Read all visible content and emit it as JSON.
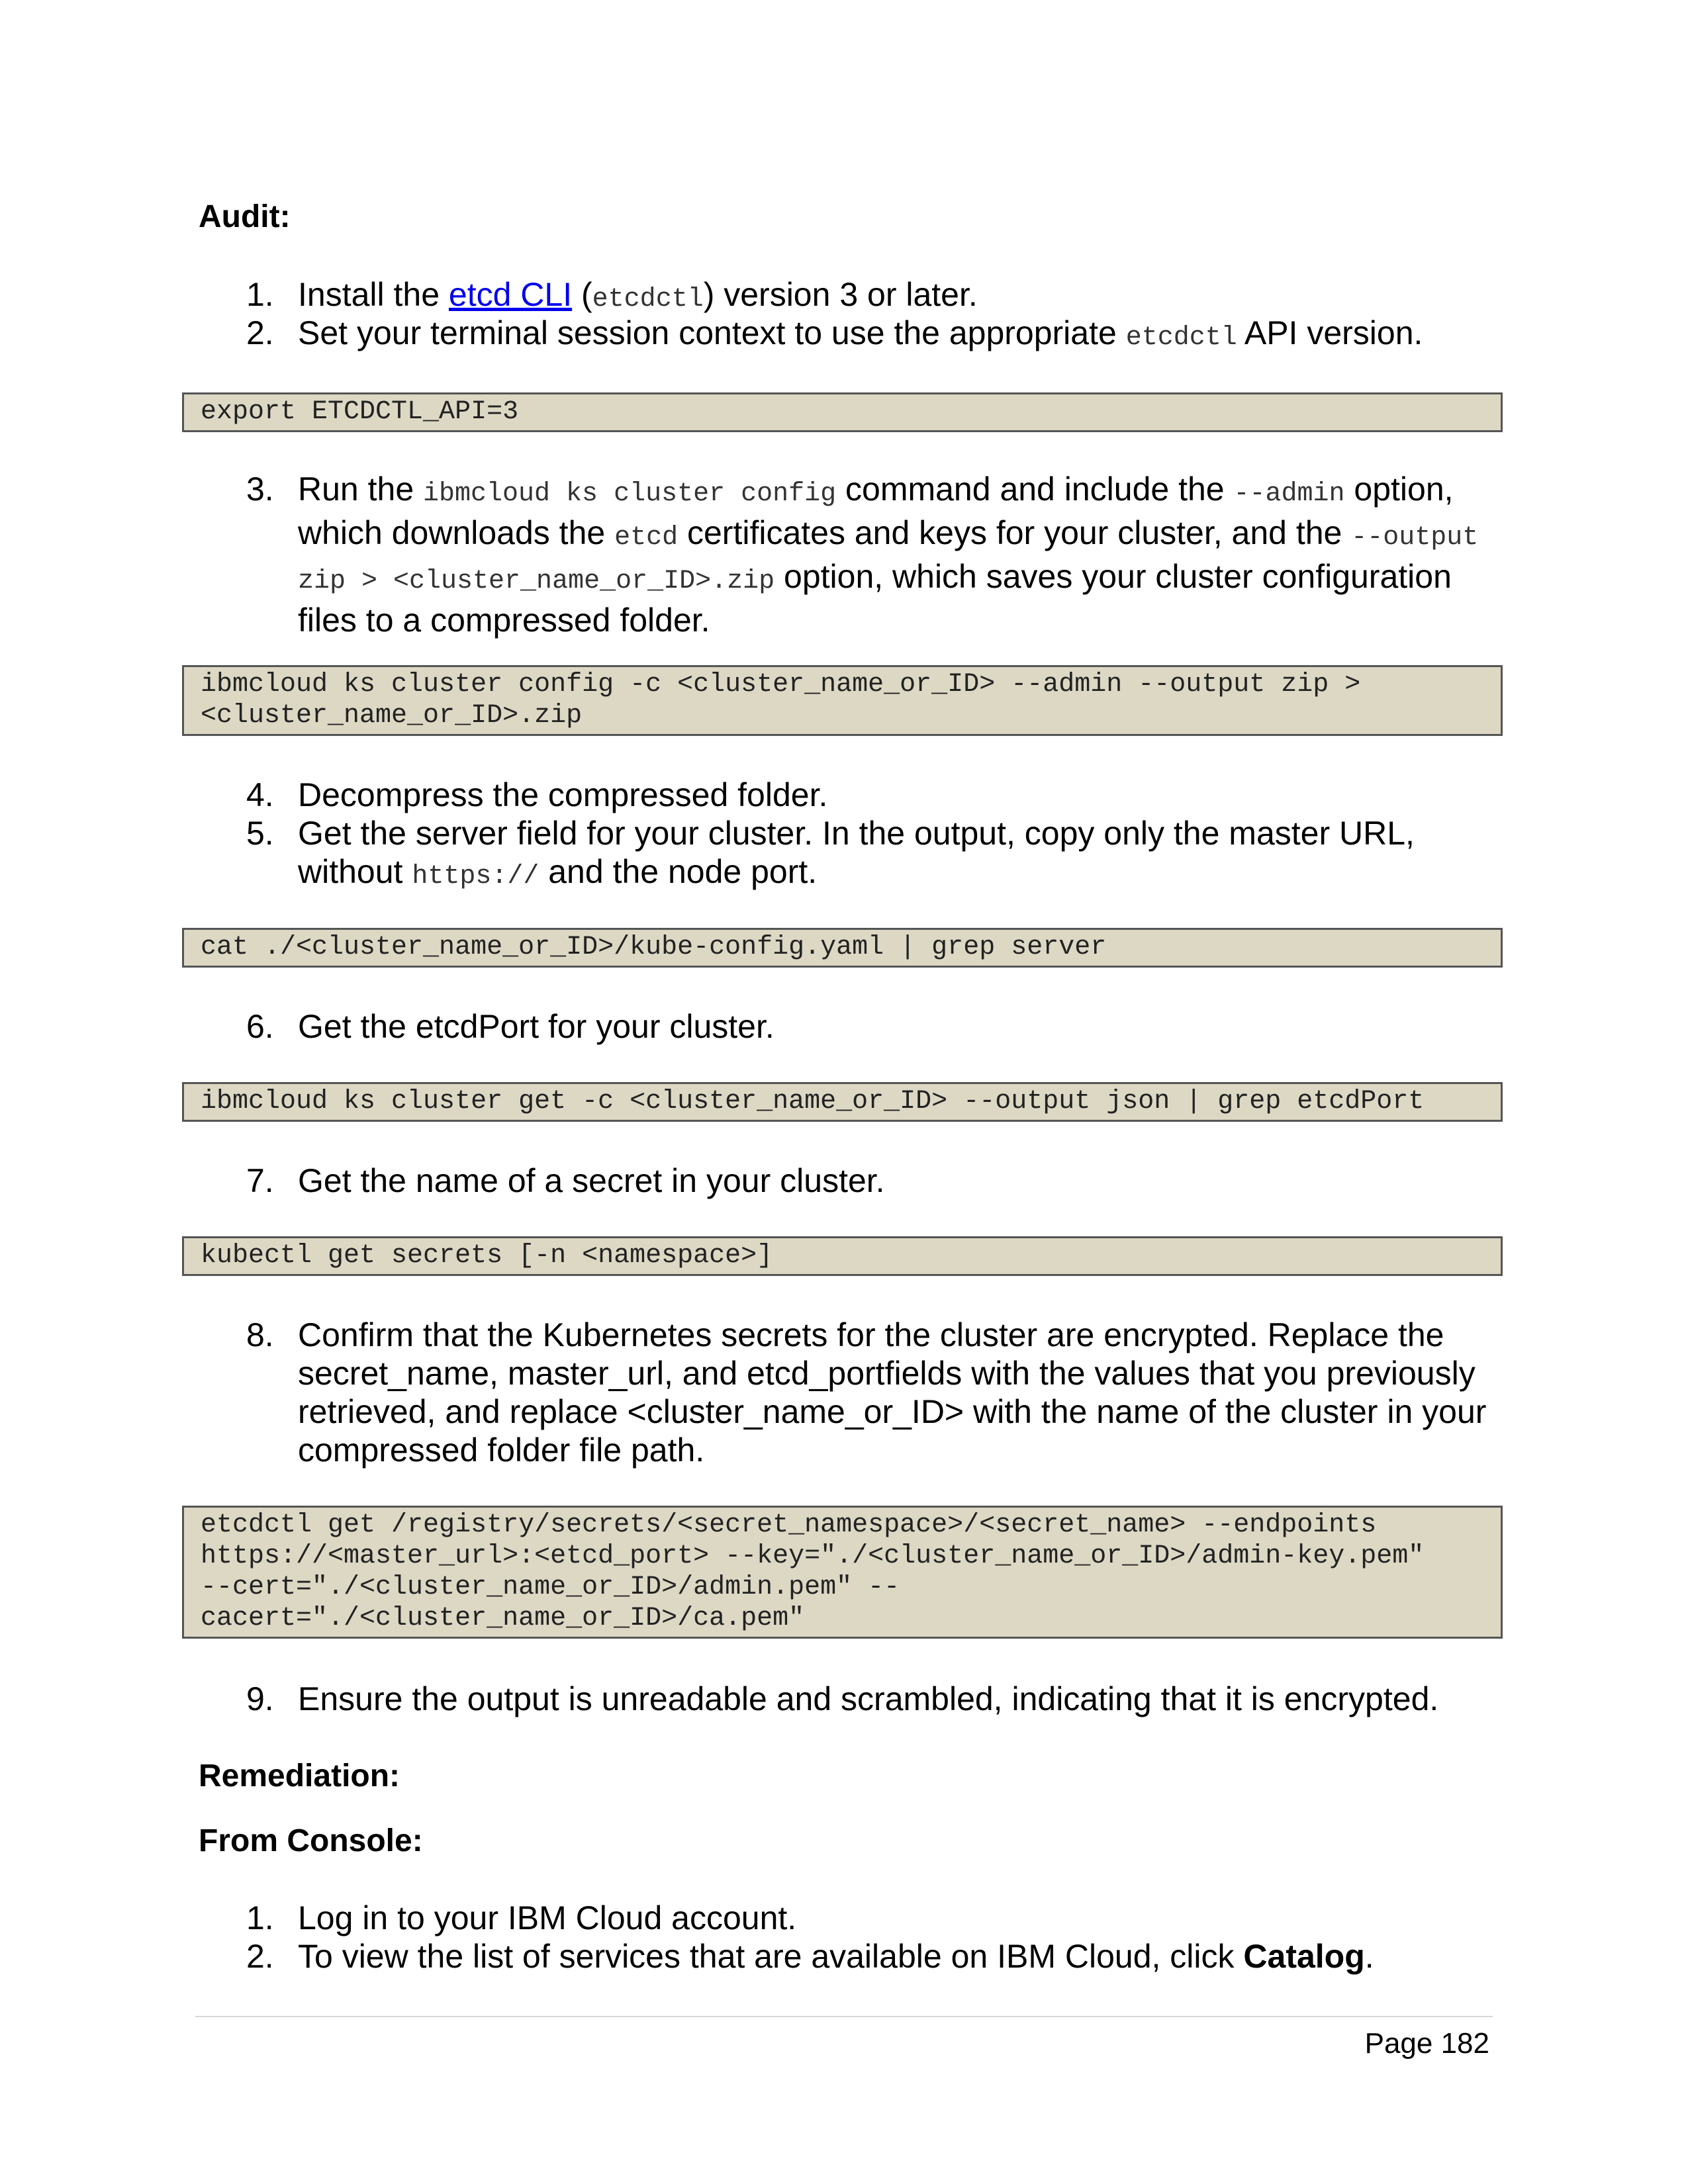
{
  "audit": {
    "heading": "Audit:",
    "steps": {
      "s1": {
        "num": "1.",
        "t1": "Install the ",
        "link": "etcd CLI",
        "t2": " (",
        "code": "etcdctl",
        "t3": ") version 3 or later."
      },
      "s2": {
        "num": "2.",
        "t1": "Set your terminal session context to use the appropriate ",
        "code": "etcdctl",
        "t2": " API version."
      },
      "s3": {
        "num": "3.",
        "t1": "Run the ",
        "code1": "ibmcloud ks cluster config",
        "t2": " command and include the ",
        "code2": "--admin",
        "t3": " option, which downloads the ",
        "code3": "etcd",
        "t4": " certificates and keys for your cluster, and the ",
        "code4": "--output zip > <cluster_name_or_ID>.zip",
        "t5": " option, which saves your cluster configuration files to a compressed folder."
      },
      "s4": {
        "num": "4.",
        "t1": "Decompress the compressed folder."
      },
      "s5": {
        "num": "5.",
        "t1": "Get the server field for your cluster. In the output, copy only the master URL, without ",
        "code": "https://",
        "t2": " and the node port."
      },
      "s6": {
        "num": "6.",
        "t1": "Get the etcdPort for your cluster."
      },
      "s7": {
        "num": "7.",
        "t1": "Get the name of a secret in your cluster."
      },
      "s8": {
        "num": "8.",
        "t1": "Confirm that the Kubernetes secrets for the cluster are encrypted. Replace the secret_name, master_url, and etcd_portfields with the values that you previously retrieved, and replace <cluster_name_or_ID> with the name of the cluster in your compressed folder file path."
      },
      "s9": {
        "num": "9.",
        "t1": "Ensure the output is unreadable and scrambled, indicating that it is encrypted."
      }
    },
    "code_blocks": {
      "c1": "export ETCDCTL_API=3",
      "c2": "ibmcloud ks cluster config -c <cluster_name_or_ID> --admin --output zip >\n<cluster_name_or_ID>.zip",
      "c3": "cat ./<cluster_name_or_ID>/kube-config.yaml | grep server",
      "c4": "ibmcloud ks cluster get -c <cluster_name_or_ID> --output json | grep etcdPort",
      "c5": "kubectl get secrets [-n <namespace>]",
      "c6": "etcdctl get /registry/secrets/<secret_namespace>/<secret_name> --endpoints\nhttps://<master_url>:<etcd_port> --key=\"./<cluster_name_or_ID>/admin-key.pem\"\n--cert=\"./<cluster_name_or_ID>/admin.pem\" --\ncacert=\"./<cluster_name_or_ID>/ca.pem\""
    }
  },
  "remediation": {
    "heading": "Remediation:",
    "subheading": "From Console:",
    "steps": {
      "r1": {
        "num": "1.",
        "t1": "Log in to your IBM Cloud account."
      },
      "r2": {
        "num": "2.",
        "t1": "To view the list of services that are available on IBM Cloud, click ",
        "bold": "Catalog",
        "t2": "."
      }
    }
  },
  "footer": {
    "page_label": "Page 182"
  },
  "colors": {
    "code_background": "#ddd8c4",
    "link": "#0000ee"
  }
}
